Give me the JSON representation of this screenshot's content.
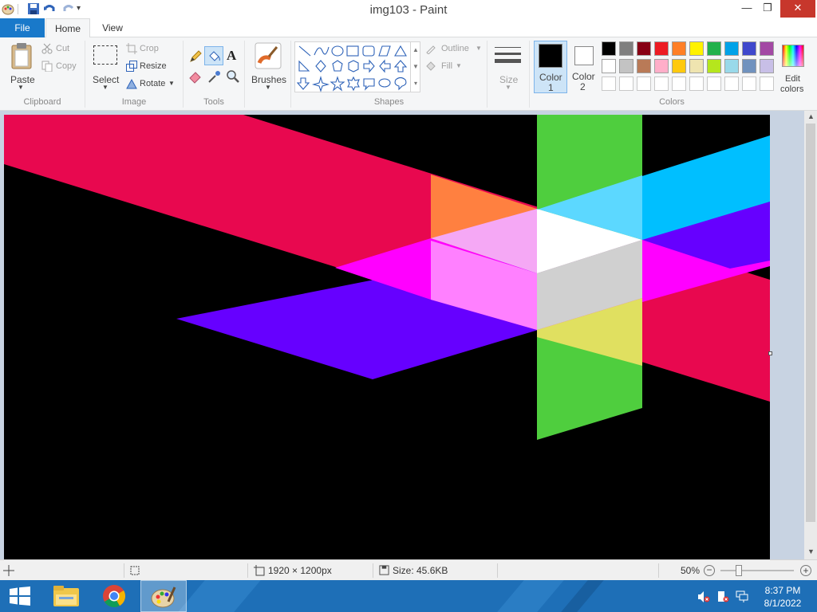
{
  "window": {
    "title": "img103 - Paint",
    "minimize": "—",
    "maximize": "❐",
    "close": "✕"
  },
  "tabs": {
    "file": "File",
    "home": "Home",
    "view": "View"
  },
  "ribbon": {
    "clipboard": {
      "label": "Clipboard",
      "paste": "Paste",
      "cut": "Cut",
      "copy": "Copy"
    },
    "image": {
      "label": "Image",
      "select": "Select",
      "crop": "Crop",
      "resize": "Resize",
      "rotate": "Rotate"
    },
    "tools": {
      "label": "Tools"
    },
    "brushes": {
      "label": "Brushes"
    },
    "shapes": {
      "label": "Shapes",
      "outline": "Outline",
      "fill": "Fill"
    },
    "size": {
      "label": "Size"
    },
    "color1": {
      "line1": "Color",
      "line2": "1",
      "value": "#000000"
    },
    "color2": {
      "line1": "Color",
      "line2": "2",
      "value": "#ffffff"
    },
    "colors": {
      "label": "Colors"
    },
    "edit_colors": {
      "line1": "Edit",
      "line2": "colors"
    },
    "palette": [
      [
        "#000000",
        "#7f7f7f",
        "#880015",
        "#ed1c24",
        "#ff7f27",
        "#fff200",
        "#22b14c",
        "#00a2e8",
        "#3f48cc",
        "#a349a4"
      ],
      [
        "#ffffff",
        "#c3c3c3",
        "#b97a57",
        "#ffaec9",
        "#ffc90e",
        "#efe4b0",
        "#b5e61d",
        "#99d9ea",
        "#7092be",
        "#c8bfe7"
      ]
    ]
  },
  "status": {
    "dimensions": "1920 × 1200px",
    "size": "Size: 45.6KB",
    "zoom": "50%",
    "zoom_level": 0.5
  },
  "taskbar": {
    "time": "8:37 PM",
    "date": "8/1/2022",
    "apps": [
      "windows-start",
      "file-explorer",
      "chrome",
      "paint"
    ]
  },
  "colors": {
    "accent": "#1979ca",
    "taskbar": "#1e6fb7",
    "canvas_bg": "#000000",
    "red_band": "#e8084f",
    "green_band": "#4fce3e",
    "cyan_band": "#00bfff",
    "violet_band": "#6600ff"
  }
}
